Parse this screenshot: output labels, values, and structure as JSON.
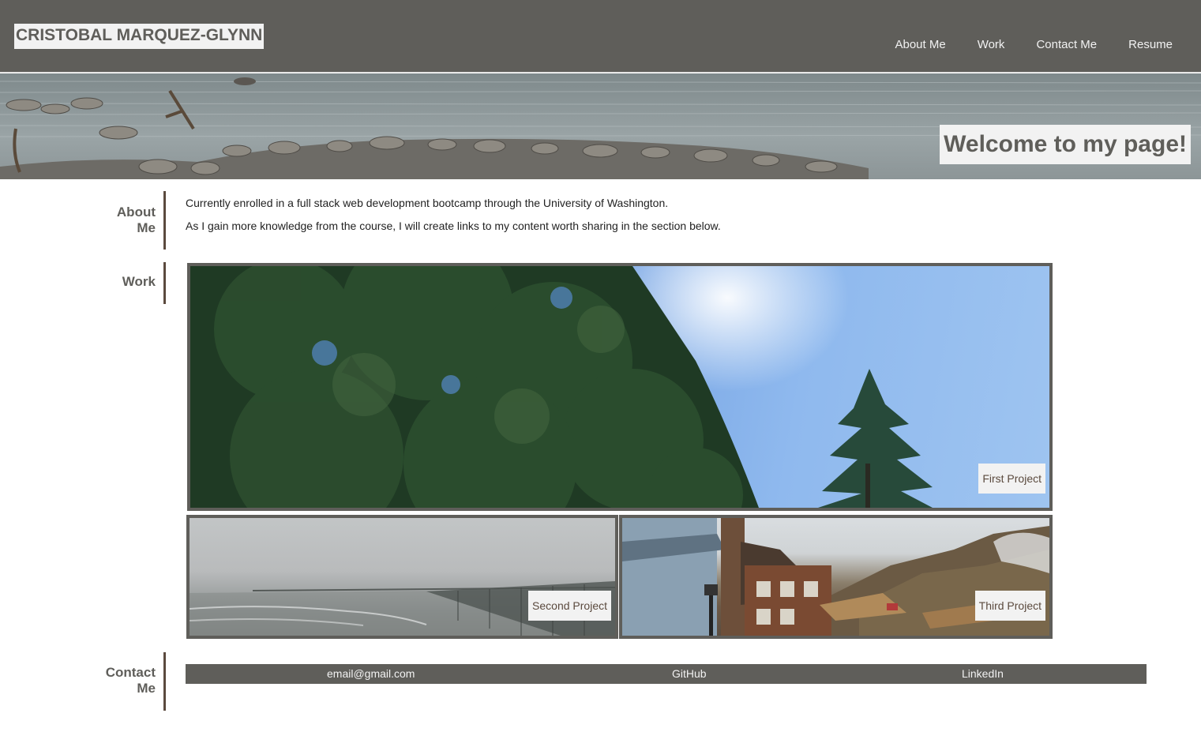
{
  "header": {
    "site_title": "CRISTOBAL MARQUEZ-GLYNN",
    "nav": [
      "About Me",
      "Work",
      "Contact Me",
      "Resume"
    ],
    "background_color": "#5f5e5a"
  },
  "hero": {
    "welcome": "Welcome to my page!"
  },
  "about": {
    "label_line1": "About",
    "label_line2": "Me",
    "paragraphs": [
      "Currently enrolled in a full stack web development bootcamp through the University of Washington.",
      "As I gain more knowledge from the course, I will create links to my content worth sharing in the section below."
    ]
  },
  "work": {
    "label": "Work",
    "projects": [
      {
        "caption": "First Project"
      },
      {
        "caption": "Second Project"
      },
      {
        "caption": "Third Project"
      }
    ]
  },
  "contact": {
    "label_line1": "Contact",
    "label_line2": "Me",
    "links": [
      "email@gmail.com",
      "GitHub",
      "LinkedIn"
    ]
  },
  "colors": {
    "accent_brown": "#5b4a3e",
    "gray": "#5f5e5a",
    "light": "#f2f2f2"
  }
}
